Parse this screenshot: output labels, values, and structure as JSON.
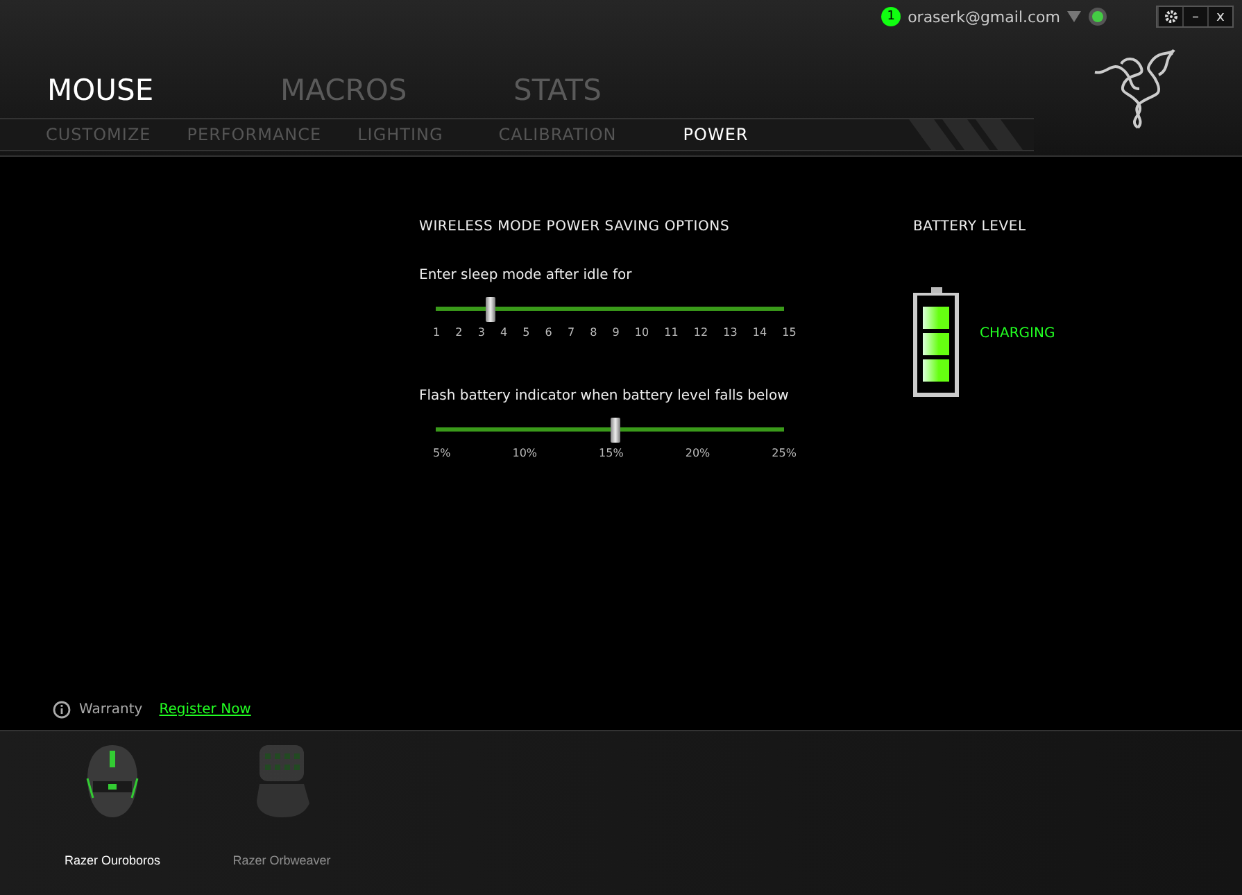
{
  "account": {
    "notifications": "1",
    "email": "oraserk@gmail.com"
  },
  "window_controls": {
    "minimize": "–",
    "close": "x"
  },
  "main_tabs": [
    {
      "label": "MOUSE",
      "selected": true
    },
    {
      "label": "MACROS",
      "selected": false
    },
    {
      "label": "STATS",
      "selected": false
    }
  ],
  "sub_tabs": [
    {
      "label": "CUSTOMIZE",
      "selected": false
    },
    {
      "label": "PERFORMANCE",
      "selected": false
    },
    {
      "label": "LIGHTING",
      "selected": false
    },
    {
      "label": "CALIBRATION",
      "selected": false
    },
    {
      "label": "POWER",
      "selected": true
    }
  ],
  "power": {
    "title": "WIRELESS MODE POWER SAVING OPTIONS",
    "sliders": [
      {
        "label": "Enter sleep mode after idle for",
        "level": 0.143,
        "ticks": [
          "1",
          "2",
          "3",
          "4",
          "5",
          "6",
          "7",
          "8",
          "9",
          "10",
          "11",
          "12",
          "13",
          "14",
          "15"
        ]
      },
      {
        "label": "Flash battery indicator when battery level falls below",
        "level": 0.5,
        "ticks": [
          "5%",
          "10%",
          "15%",
          "20%",
          "25%"
        ]
      }
    ]
  },
  "battery": {
    "title": "BATTERY LEVEL",
    "level": 1,
    "status": "CHARGING"
  },
  "warranty": {
    "label": "Warranty",
    "link": "Register Now"
  },
  "devices": [
    {
      "name": "Razer Ouroboros",
      "selected": true
    },
    {
      "name": "Razer Orbweaver",
      "selected": false
    }
  ]
}
